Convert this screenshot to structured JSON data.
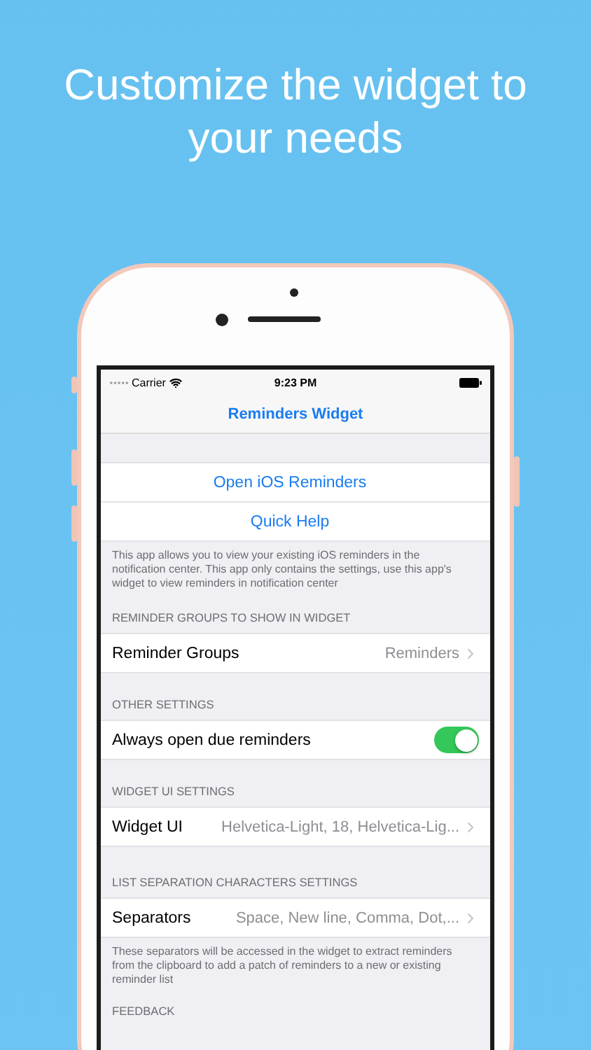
{
  "headline": "Customize the widget to your needs",
  "phone": {
    "status_bar": {
      "carrier": "Carrier",
      "time": "9:23 PM"
    },
    "nav_title": "Reminders Widget",
    "sections": [
      {
        "rows": [
          {
            "kind": "action",
            "label": "Open iOS Reminders"
          },
          {
            "kind": "action",
            "label": "Quick Help"
          }
        ],
        "footer": "This app allows you to view your existing iOS reminders in the notification center. This app only contains the settings, use this app's widget to view reminders in notification center"
      },
      {
        "header": "REMINDER GROUPS TO SHOW IN WIDGET",
        "rows": [
          {
            "kind": "disclosure",
            "label": "Reminder Groups",
            "value": "Reminders"
          }
        ]
      },
      {
        "header": "OTHER SETTINGS",
        "rows": [
          {
            "kind": "toggle",
            "label": "Always open due reminders",
            "on": true
          }
        ]
      },
      {
        "header": "WIDGET UI SETTINGS",
        "rows": [
          {
            "kind": "disclosure",
            "label": "Widget UI",
            "value": "Helvetica-Light, 18, Helvetica-Lig..."
          }
        ]
      },
      {
        "header": "LIST SEPARATION CHARACTERS SETTINGS",
        "rows": [
          {
            "kind": "disclosure",
            "label": "Separators",
            "value": "Space, New line, Comma, Dot,..."
          }
        ],
        "footer": "These separators will be accessed in the widget to extract reminders from the clipboard to add a patch of reminders to a new or existing reminder list"
      },
      {
        "header": "FEEDBACK"
      }
    ]
  }
}
